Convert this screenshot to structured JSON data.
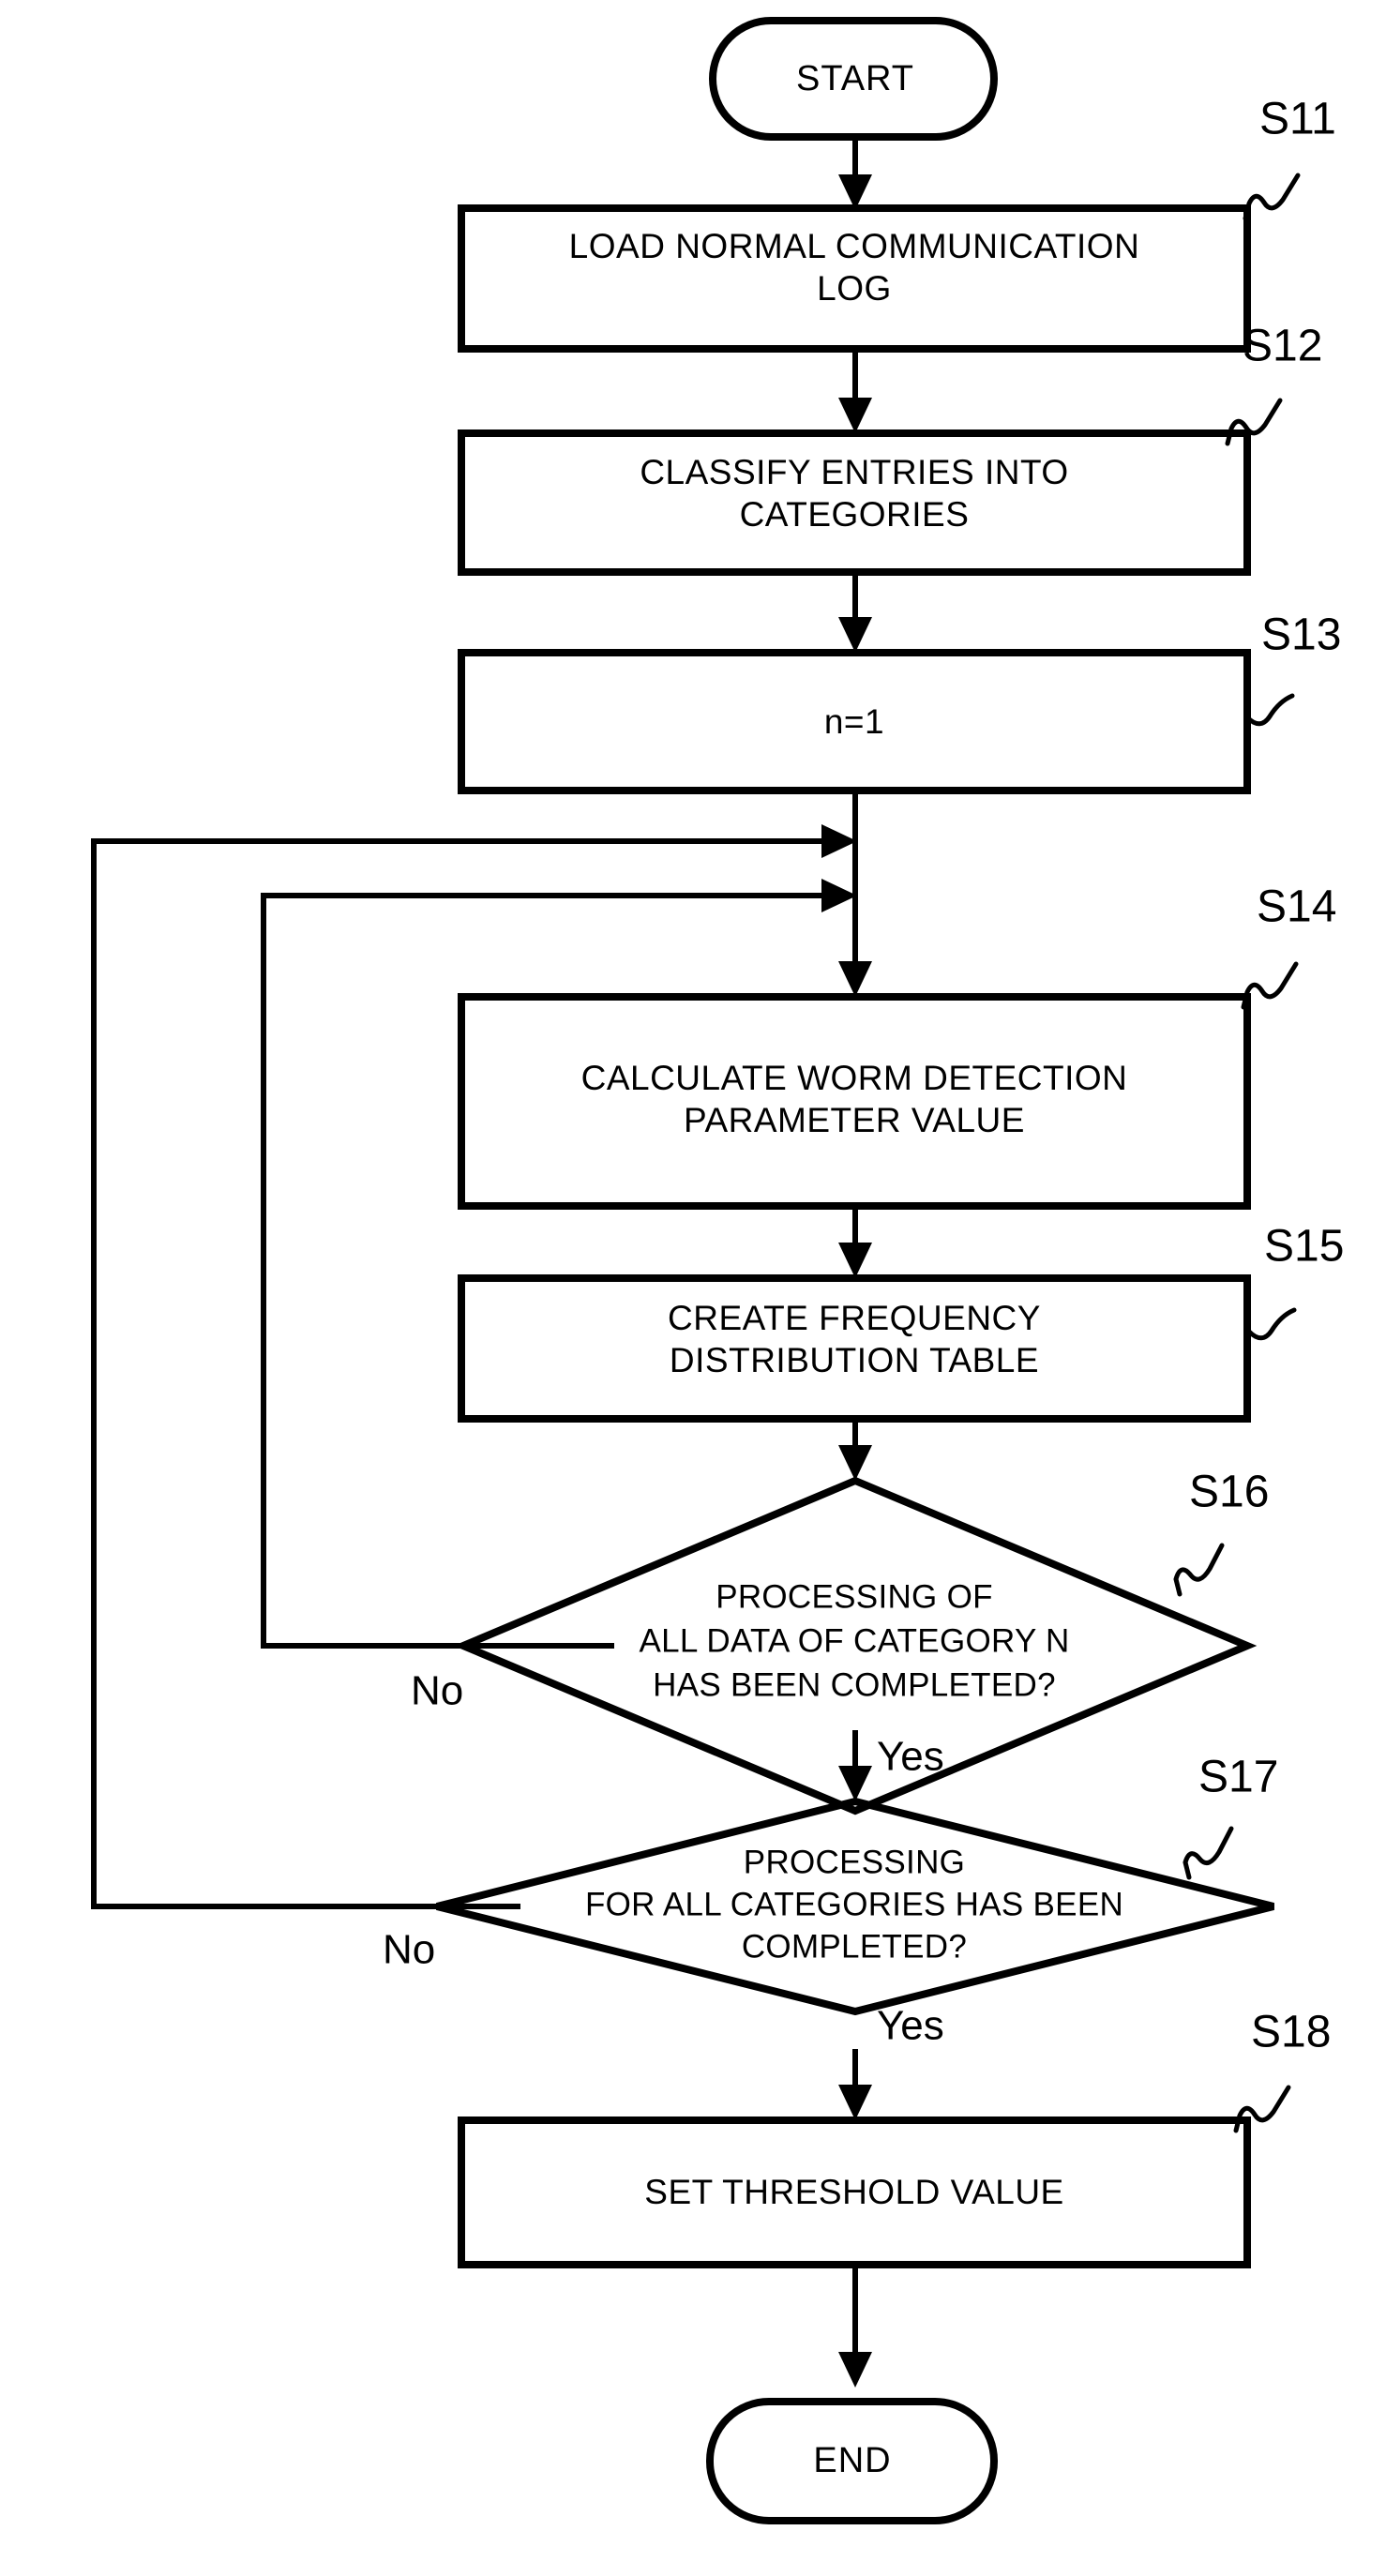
{
  "diagram": {
    "title": "Worm detection threshold setting flowchart",
    "background_color": "#ffffff",
    "line_color": "#000000"
  },
  "nodes": {
    "start": {
      "label": "START",
      "shape": "terminator"
    },
    "s11": {
      "step": "S11",
      "shape": "process",
      "lines": [
        "LOAD NORMAL COMMUNICATION",
        "LOG"
      ]
    },
    "s12": {
      "step": "S12",
      "shape": "process",
      "lines": [
        "CLASSIFY ENTRIES INTO",
        "CATEGORIES"
      ]
    },
    "s13": {
      "step": "S13",
      "shape": "process",
      "lines": [
        "n=1"
      ]
    },
    "s14": {
      "step": "S14",
      "shape": "process",
      "lines": [
        "CALCULATE WORM DETECTION",
        "PARAMETER VALUE"
      ]
    },
    "s15": {
      "step": "S15",
      "shape": "process",
      "lines": [
        "CREATE FREQUENCY",
        "DISTRIBUTION TABLE"
      ]
    },
    "s16": {
      "step": "S16",
      "shape": "decision",
      "lines": [
        "PROCESSING OF",
        "ALL DATA OF CATEGORY N",
        "HAS BEEN COMPLETED?"
      ]
    },
    "s17": {
      "step": "S17",
      "shape": "decision",
      "lines": [
        "PROCESSING",
        "FOR ALL CATEGORIES HAS BEEN",
        "COMPLETED?"
      ]
    },
    "s18": {
      "step": "S18",
      "shape": "process",
      "lines": [
        "SET THRESHOLD VALUE"
      ]
    },
    "end": {
      "label": "END",
      "shape": "terminator"
    }
  },
  "branch_labels": {
    "s16_no": "No",
    "s16_yes": "Yes",
    "s17_no": "No",
    "s17_yes": "Yes"
  }
}
